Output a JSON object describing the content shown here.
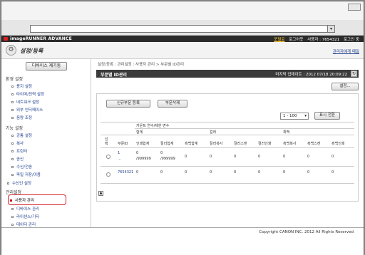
{
  "brand": "imageRUNNER ADVANCE",
  "top_links": {
    "portal": "포털로",
    "logout": "로그아웃",
    "user": "사용자 : 7654321",
    "login": "로그인 중"
  },
  "page_title": "설정/등록",
  "admin_mail": "관리자에게 메일",
  "sidebar": {
    "device_button": "디바이스 제기동",
    "sections": {
      "env": "환경 설정",
      "func": "기능 설정",
      "admin": "관리설정"
    },
    "env_items": [
      "용지 설정",
      "타이머/전력 설정",
      "네트워크 설정",
      "외부 인터페이스",
      "음량 조정"
    ],
    "func_items": [
      "공통 설정",
      "복사",
      "프린터",
      "송신",
      "수신/전송",
      "파일 저장/이용"
    ],
    "scan_item": "수신인 설정",
    "admin_items": [
      "사용자 관리",
      "디바이스 관리",
      "라이센스/기타",
      "데이터 관리"
    ]
  },
  "breadcrumb": "설정/등록 : 관리설정 : 사용자 관리 > 부문별 ID관리",
  "panel": {
    "title": "부문별 ID관리",
    "last_update": "마지막 업데이트 : 2012 07/18 20:09:22",
    "settings_button": "설정...",
    "register_button": "신규부문 등록",
    "delete_button": "부문삭제",
    "pager_value": "1 - 100",
    "show_button": "표시 전환",
    "counter_header": "카운트 연수/제한 면수",
    "group_total": "합계",
    "group_color": "컬러",
    "group_bw": "흑백",
    "col_select": "선택",
    "col_dept": "부문ID",
    "cols": [
      "인쇄합계",
      "컬러합계",
      "흑백합계",
      "컬러복사",
      "컬러스캔",
      "컬러인쇄",
      "흑백복사",
      "흑백스캔",
      "흑백인쇄"
    ],
    "rows": [
      {
        "dept": "1",
        "dept2": "...",
        "values": [
          "0",
          "0",
          "0",
          "0",
          "0",
          "0",
          "0",
          "0",
          "0"
        ],
        "limits": [
          "/999999",
          "/999999"
        ]
      },
      {
        "dept": "7654321",
        "dept2": "",
        "values": [
          "0",
          "0",
          "0",
          "0",
          "0",
          "0",
          "0",
          "0",
          "0"
        ],
        "limits": [
          "",
          ""
        ]
      }
    ]
  },
  "copyright": "Copyright CANON INC. 2012 All Rights Reserved"
}
